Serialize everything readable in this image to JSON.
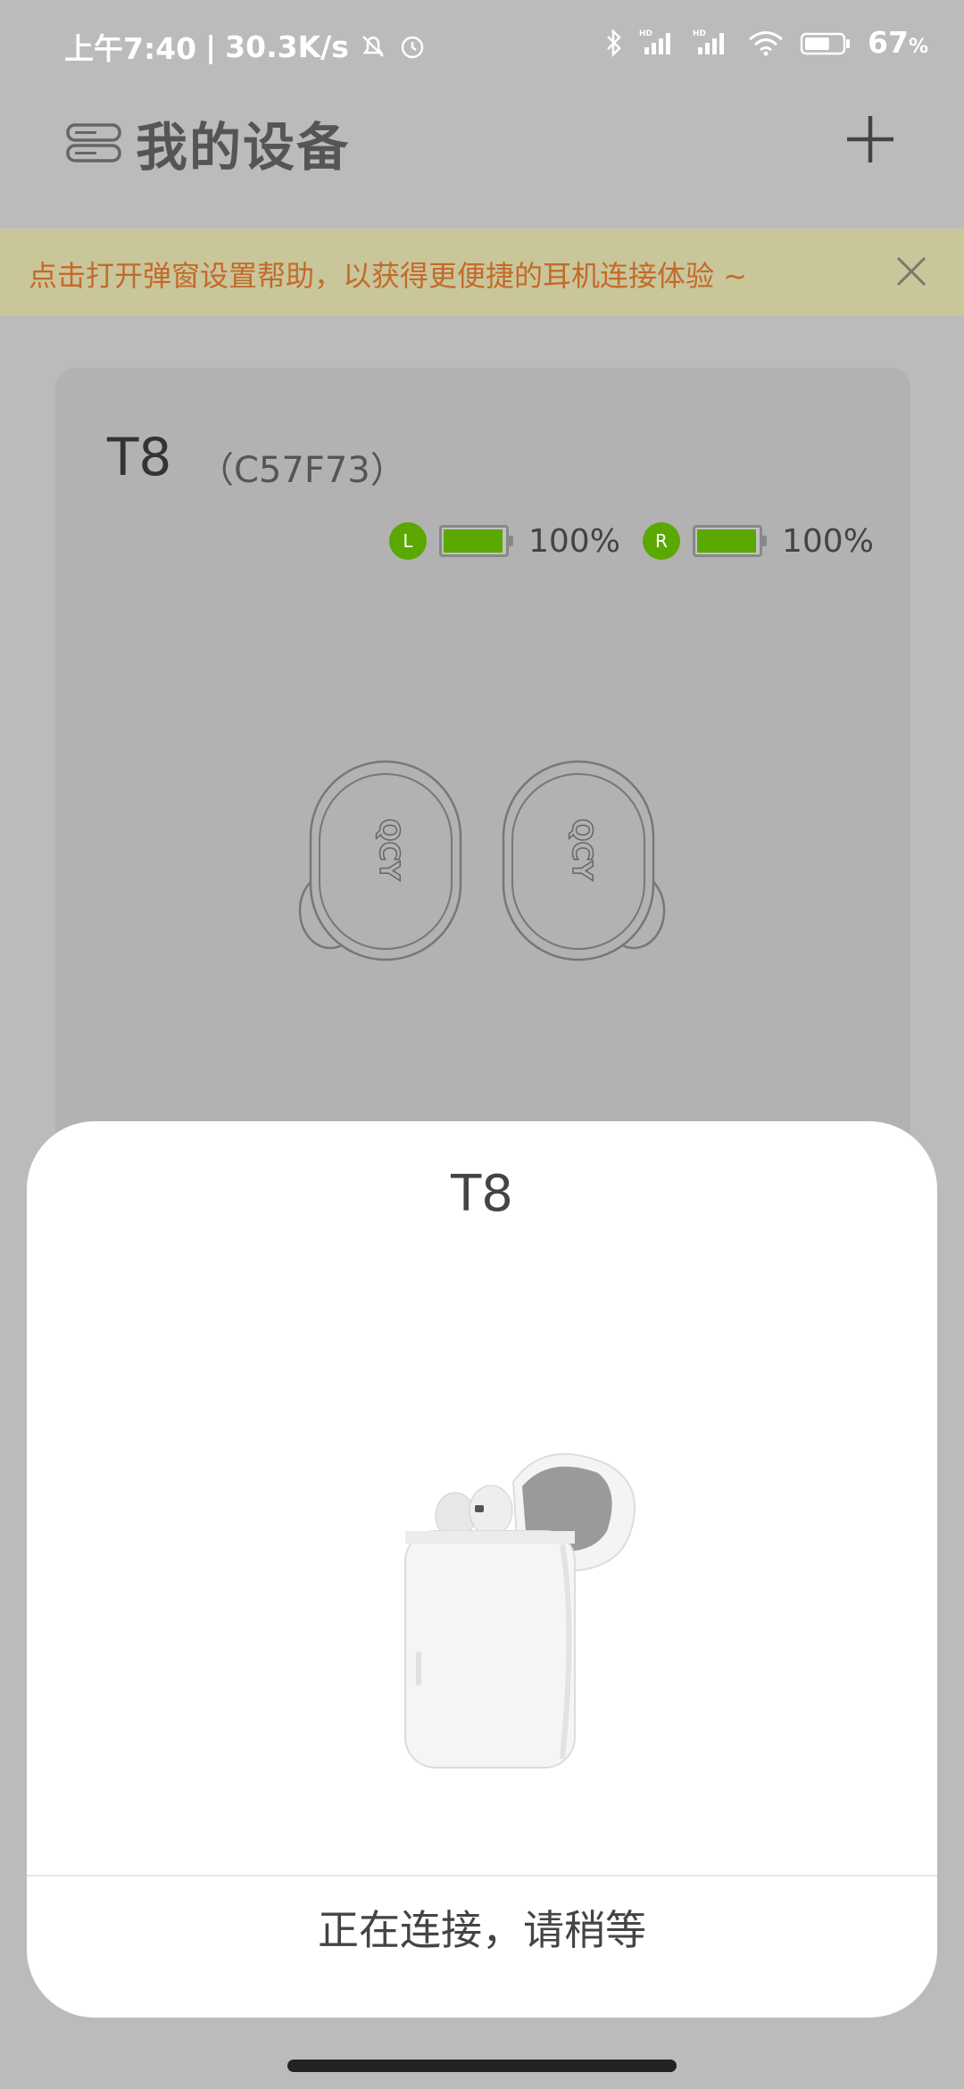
{
  "status_bar": {
    "time": "上午7:40",
    "speed": "30.3K/s",
    "battery_percent": "67",
    "battery_level": 0.67,
    "icons": [
      "mute-bell-icon",
      "alarm-icon",
      "bluetooth-icon",
      "signal-hd-icon",
      "signal-hd-icon",
      "wifi-icon",
      "battery-icon"
    ]
  },
  "header": {
    "title": "我的设备",
    "menu_icon": "devices-menu-icon",
    "add_icon": "plus-icon"
  },
  "banner": {
    "text": "点击打开弹窗设置帮助，以获得更便捷的耳机连接体验 ~",
    "close_icon": "close-icon"
  },
  "device_card": {
    "name": "T8",
    "id": "（C57F73）",
    "left": {
      "label": "L",
      "percent_text": "100%",
      "level": 1.0
    },
    "right": {
      "label": "R",
      "percent_text": "100%",
      "level": 1.0
    },
    "logo": "QCY"
  },
  "popup": {
    "title": "T8",
    "status": "正在连接，请稍等"
  },
  "colors": {
    "accent_green": "#5aa800",
    "banner_bg": "#c9c69a",
    "banner_text": "#c46a2a"
  }
}
